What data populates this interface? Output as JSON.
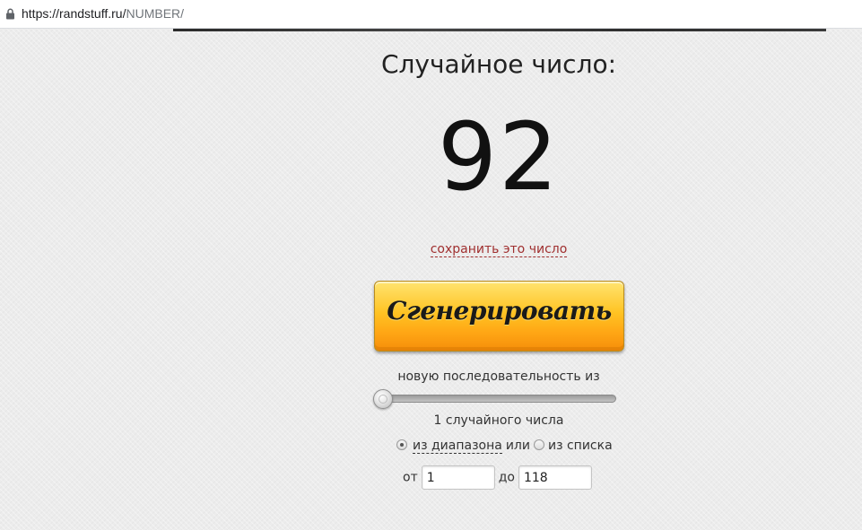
{
  "browser": {
    "url_base": "https://randstuff.ru/",
    "url_path": "NUMBER/"
  },
  "page": {
    "heading": "Случайное число:",
    "number": "92",
    "save_link": "сохранить это число",
    "generate_button": "Сгенерировать",
    "sequence_label": "новую последовательность из",
    "slider": {
      "value": 1
    },
    "count_label": "1 случайного числа",
    "mode": {
      "range_label": "из диапазона",
      "or_label": "или",
      "list_label": "из списка",
      "selected": "range"
    },
    "range": {
      "from_label": "от",
      "from_value": "1",
      "to_label": "до",
      "to_value": "118"
    }
  },
  "colors": {
    "button_top": "#ffe470",
    "button_bottom": "#f58e0a",
    "link": "#a03030",
    "background": "#ececec"
  }
}
